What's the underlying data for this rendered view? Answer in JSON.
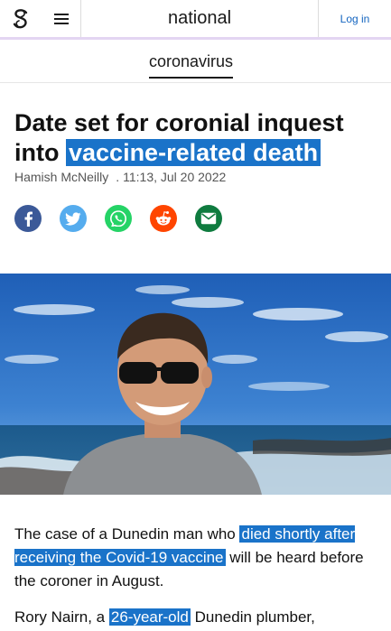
{
  "nav": {
    "logo_icon": "stuff-s-logo-icon",
    "menu_icon": "hamburger-menu-icon",
    "section": "national",
    "login": "Log in",
    "accent_color": "#e3d5f2"
  },
  "topic": "coronavirus",
  "article": {
    "headline_plain": "Date set for coronial inquest into",
    "headline_highlight": "vaccine-related death",
    "author": "Hamish McNeilly",
    "separator": ".",
    "timestamp": "11:13, Jul 20 2022",
    "highlight_color": "#1a73c9"
  },
  "share": [
    {
      "name": "facebook-icon",
      "color": "#3b5998"
    },
    {
      "name": "twitter-icon",
      "color": "#55acee"
    },
    {
      "name": "whatsapp-icon",
      "color": "#25d366"
    },
    {
      "name": "reddit-icon",
      "color": "#ff4500"
    },
    {
      "name": "email-icon",
      "color": "#0f7b3f"
    }
  ],
  "body": {
    "p1_a": "The case of a Dunedin man who ",
    "p1_hl": "died shortly after receiving the Covid-19 vaccine",
    "p1_b": " will be heard before the coroner in August.",
    "p2_a": "Rory Nairn, a ",
    "p2_hl": "26-year-old",
    "p2_b": " Dunedin plumber,"
  }
}
